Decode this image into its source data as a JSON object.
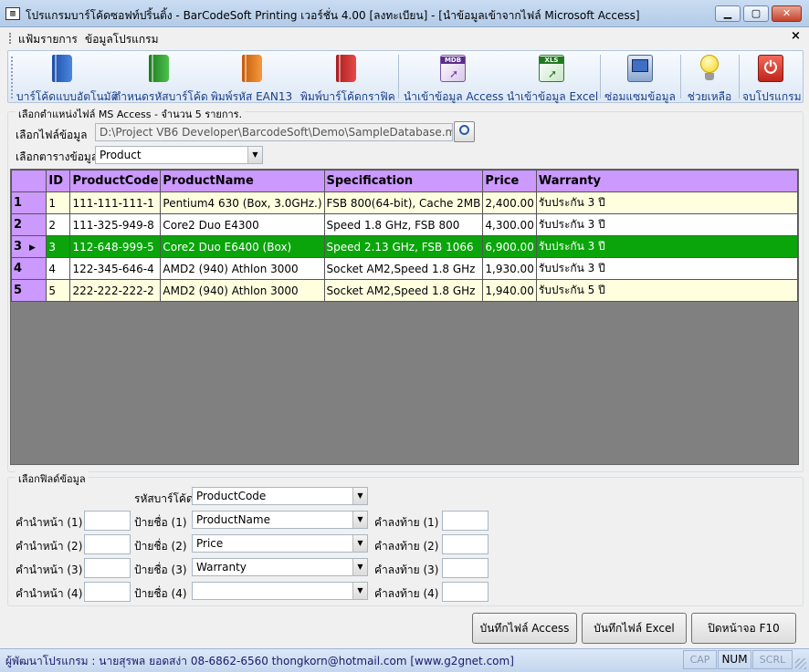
{
  "window": {
    "title": "โปรแกรมบาร์โค้ดซอฟท์ปริ้นติ้ง - BarCodeSoft Printing เวอร์ชั่น 4.00 [ลงทะเบียน] - [นำข้อมูลเข้าจากไฟล์ Microsoft Access]",
    "minimize": "▁",
    "maximize": "▢",
    "close": "✕",
    "mdi_close": "×"
  },
  "menu": {
    "items": [
      "แฟ้มรายการ",
      "ข้อมูลโปรแกรม"
    ]
  },
  "toolbar": {
    "items": [
      {
        "label": "บาร์โค้ดแบบอัตโนมัติ",
        "icon": "blue-book-icon"
      },
      {
        "label": "กำหนดรหัสบาร์โค้ด",
        "icon": "green-book-icon"
      },
      {
        "label": "พิมพ์รหัส EAN13",
        "icon": "orange-book-icon"
      },
      {
        "label": "พิมพ์บาร์โค้ดกราฟิค",
        "icon": "red-book-icon"
      },
      {
        "label": "นำเข้าข้อมูล Access",
        "icon": "mdb-file-icon",
        "badge": "MDB"
      },
      {
        "label": "นำเข้าข้อมูล Excel",
        "icon": "xls-file-icon",
        "badge": "XLS"
      },
      {
        "label": "ซ่อมแซมข้อมูล",
        "icon": "computer-repair-icon"
      },
      {
        "label": "ช่วยเหลือ",
        "icon": "lightbulb-icon"
      },
      {
        "label": "จบโปรแกรม",
        "icon": "power-icon"
      }
    ]
  },
  "source": {
    "group_label": "เลือกตำแหน่งไฟล์ MS Access - จำนวน 5 รายการ.",
    "file_label": "เลือกไฟล์ข้อมูล",
    "file_path": "D:\\Project VB6 Developer\\BarcodeSoft\\Demo\\SampleDatabase.mdb",
    "table_label": "เลือกตารางข้อมูล",
    "table_value": "Product"
  },
  "grid": {
    "columns": [
      "",
      "ID",
      "ProductCode",
      "ProductName",
      "Specification",
      "Price",
      "Warranty"
    ],
    "rows": [
      {
        "rh": "1",
        "id": "1",
        "code": "111-111-111-1",
        "name": "Pentium4 630 (Box, 3.0GHz.)",
        "spec": "FSB 800(64-bit), Cache 2MB",
        "price": "2,400.00",
        "warranty": "รับประกัน 3 ปี"
      },
      {
        "rh": "2",
        "id": "2",
        "code": "111-325-949-8",
        "name": "Core2 Duo E4300",
        "spec": "Speed 1.8 GHz, FSB 800",
        "price": "4,300.00",
        "warranty": "รับประกัน 3 ปี"
      },
      {
        "rh": "3",
        "id": "3",
        "code": "112-648-999-5",
        "name": "Core2 Duo E6400 (Box)",
        "spec": "Speed 2.13 GHz, FSB 1066",
        "price": "6,900.00",
        "warranty": "รับประกัน 3 ปี"
      },
      {
        "rh": "4",
        "id": "4",
        "code": "122-345-646-4",
        "name": "AMD2 (940) Athlon 3000",
        "spec": "Socket AM2,Speed 1.8 GHz",
        "price": "1,930.00",
        "warranty": "รับประกัน 3 ปี"
      },
      {
        "rh": "5",
        "id": "5",
        "code": "222-222-222-2",
        "name": "AMD2 (940) Athlon 3000",
        "spec": "Socket AM2,Speed 1.8 GHz",
        "price": "1,940.00",
        "warranty": "รับประกัน 5 ปี"
      }
    ],
    "current_row_marker": "▶"
  },
  "fields": {
    "group_label": "เลือกฟิลด์ข้อมูล",
    "barcode_label": "รหัสบาร์โค้ด",
    "barcode_value": "ProductCode",
    "prefix_labels": [
      "คำนำหน้า (1)",
      "คำนำหน้า (2)",
      "คำนำหน้า (3)",
      "คำนำหน้า (4)"
    ],
    "prefix_values": [
      "",
      "",
      "",
      ""
    ],
    "label_labels": [
      "ป้ายชื่อ (1)",
      "ป้ายชื่อ (2)",
      "ป้ายชื่อ (3)",
      "ป้ายชื่อ (4)"
    ],
    "label_values": [
      "ProductName",
      "Price",
      "Warranty",
      ""
    ],
    "suffix_labels": [
      "คำลงท้าย (1)",
      "คำลงท้าย (2)",
      "คำลงท้าย (3)",
      "คำลงท้าย (4)"
    ],
    "suffix_values": [
      "",
      "",
      "",
      ""
    ]
  },
  "buttons": {
    "save_access": "บันทึกไฟล์ Access",
    "save_excel": "บันทึกไฟล์ Excel",
    "close": "ปิดหน้าจอ F10"
  },
  "status": {
    "text": "ผู้พัฒนาโปรแกรม : นายสุรพล ยอดสง่า 08-6862-6560 thongkorn@hotmail.com [www.g2gnet.com]",
    "caps": "CAP",
    "num": "NUM",
    "scrl": "SCRL"
  }
}
